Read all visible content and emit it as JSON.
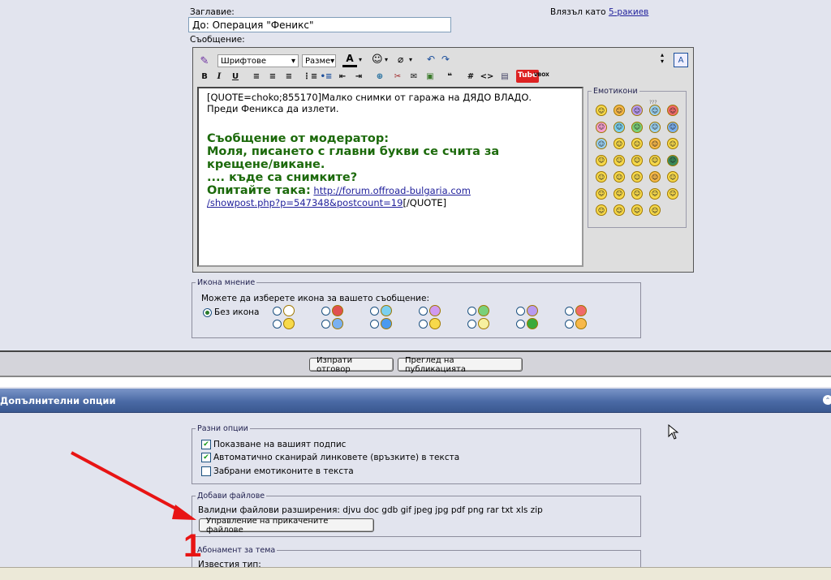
{
  "form": {
    "title_label": "Заглавие:",
    "title_value": "До: Операция \"Феникс\"",
    "logged_in_prefix": "Влязъл като",
    "logged_in_user": "5-ракиев",
    "message_label": "Съобщение:"
  },
  "toolbar": {
    "font_select": "Шрифтове",
    "size_select": "Разме",
    "bold": "B",
    "italic": "I",
    "underline": "U",
    "hash": "#",
    "code": "<>",
    "tube": "Tube",
    "vbox": "VBOX"
  },
  "editor": {
    "quote_open": "[QUOTE=choko;855170]Малко снимки от гаража на ДЯДО ВЛАДО.",
    "line2": "Преди Феникса да излети.",
    "mod_heading": "Съобщение от модератор:",
    "mod_line1": "Моля, писането с главни букви се счита за",
    "mod_line2": "крещене/викане.",
    "mod_line3": ".... къде са снимките?",
    "mod_line4": "Опитайте така:",
    "link_part1": "http://forum.offroad-bulgaria.com",
    "link_part2": "/showpost.php?p=547348&postcount=19",
    "quote_close": "[/QUOTE]"
  },
  "emoticons": {
    "legend": "Емотикони",
    "top_label": "???"
  },
  "post_icon": {
    "legend": "Икона мнение",
    "hint": "Можете да изберете икона за вашето съобщение:",
    "none_label": "Без икона"
  },
  "buttons": {
    "submit": "Изпрати отговор",
    "preview": "Преглед на публикацията"
  },
  "options": {
    "header": "Допълнителни опции",
    "misc_legend": "Разни опции",
    "opt1": "Показване на вашият подпис",
    "opt2": "Автоматично сканирай линковете (връзките) в текста",
    "opt3": "Забрани емотиконите в текста",
    "files_legend": "Добави файлове",
    "extensions": "Валидни файлови разширения: djvu doc gdb gif jpeg jpg pdf png rar txt xls zip",
    "manage_button": "Управление на прикачените файлове",
    "subscribe_legend": "Абонамент за тема",
    "notify_label": "Известия тип:"
  },
  "annotation": {
    "number": "1",
    "color": "#e81414"
  },
  "colors": {
    "header_bar": "#4a6aa5",
    "mod_green": "#1c6a0b",
    "link_blue": "#22229c"
  }
}
